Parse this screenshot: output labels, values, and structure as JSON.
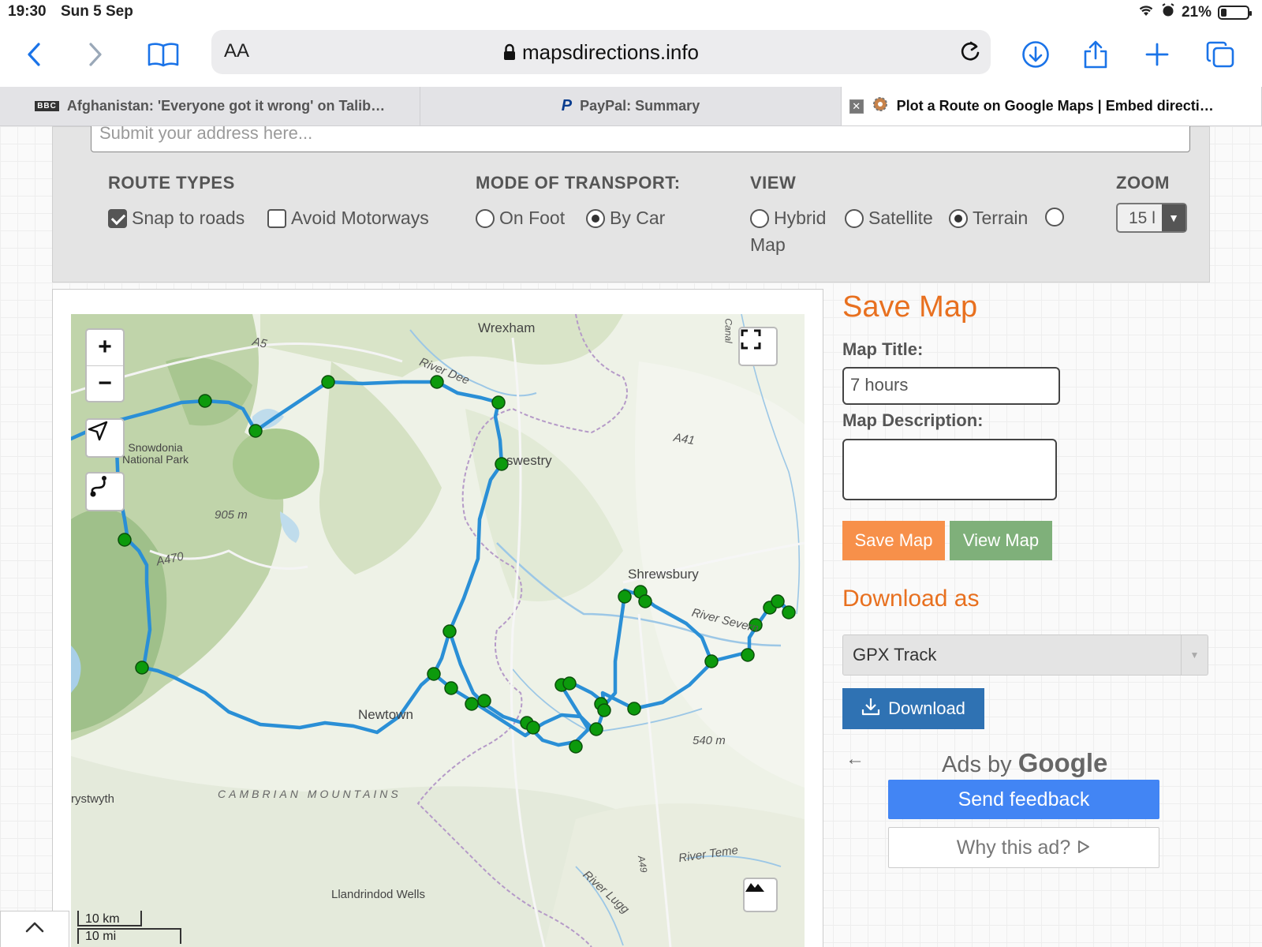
{
  "status": {
    "time": "19:30",
    "date": "Sun 5 Sep",
    "battery": "21%",
    "battery_level": 0.21
  },
  "toolbar": {
    "text_size": "AA",
    "url": "mapsdirections.info"
  },
  "tabs": [
    {
      "label": "Afghanistan: 'Everyone got it wrong' on Talib…",
      "favicon": "BBC"
    },
    {
      "label": "PayPal: Summary"
    },
    {
      "label": "Plot a Route on Google Maps | Embed directi…"
    }
  ],
  "address": {
    "placeholder": "Submit your address here..."
  },
  "options": {
    "route_types": {
      "heading": "ROUTE TYPES",
      "snap": "Snap to roads",
      "snap_checked": true,
      "avoid": "Avoid Motorways",
      "avoid_checked": false
    },
    "transport": {
      "heading": "MODE OF TRANSPORT:",
      "foot": "On Foot",
      "car": "By Car",
      "selected": "By Car"
    },
    "view": {
      "heading": "VIEW",
      "hybrid": "Hybrid",
      "satellite": "Satellite",
      "terrain": "Terrain",
      "map": "Map",
      "selected": "Terrain"
    },
    "zoom": {
      "heading": "ZOOM",
      "value": "15 l"
    }
  },
  "map": {
    "labels": {
      "wrexham": "Wrexham",
      "a5": "A5",
      "river_dee": "River Dee",
      "snowdonia": "Snowdonia National Park",
      "oswestry": "swestry",
      "a41": "A41",
      "elev905": "905 m",
      "a470": "A470",
      "shrewsbury": "Shrewsbury",
      "river_severn": "River Severn",
      "newtown": "Newtown",
      "elev540": "540 m",
      "aberystwyth": "rystwyth",
      "cambrian": "CAMBRIAN MOUNTAINS",
      "river_teme": "River Teme",
      "a49": "A49",
      "river_lugg": "River Lugg",
      "llandrindod": "Llandrindod Wells",
      "canal": "Canal"
    },
    "scale_km": "10 km",
    "scale_mi": "10 mi",
    "colors": {
      "route": "#2a8fd6",
      "waypoint": "#0c9a0c"
    }
  },
  "panel": {
    "save_heading": "Save Map",
    "title_label": "Map Title:",
    "title_value": "7 hours",
    "desc_label": "Map Description:",
    "desc_value": "",
    "save_btn": "Save Map",
    "view_btn": "View Map",
    "download_heading": "Download as",
    "format": "GPX Track",
    "download_btn": "Download",
    "colors": {
      "accent_orange": "#e8701f",
      "save_btn": "#f7904a",
      "view_btn": "#7fb07a",
      "download_btn": "#2f72b3"
    }
  },
  "ads": {
    "by": "Ads by",
    "google": "Google",
    "feedback": "Send feedback",
    "why": "Why this ad?"
  }
}
